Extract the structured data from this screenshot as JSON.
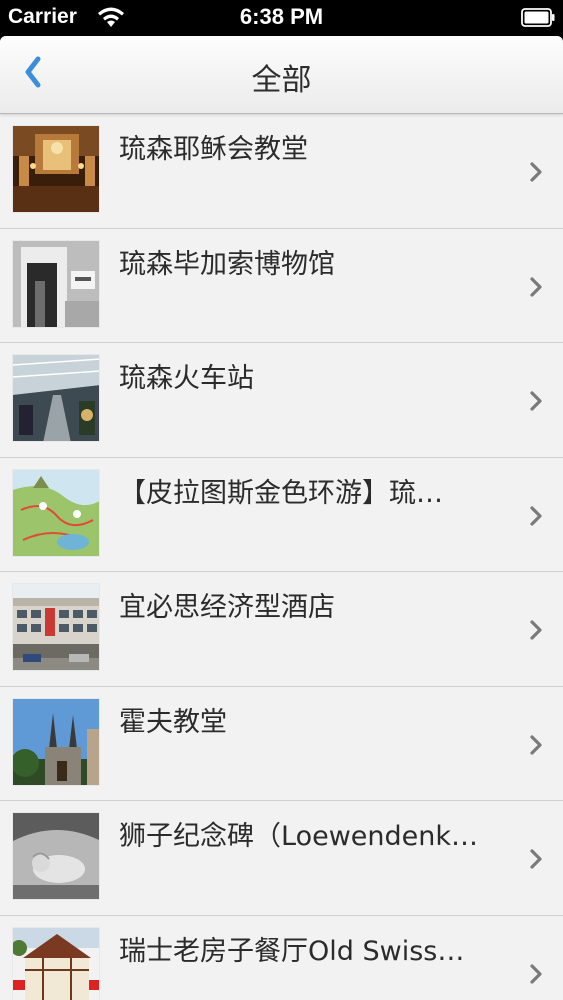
{
  "status_bar": {
    "carrier": "Carrier",
    "time": "6:38 PM",
    "icons": [
      "wifi-icon",
      "battery-icon"
    ]
  },
  "nav": {
    "title": "全部",
    "back_icon": "chevron-left-icon",
    "accent_color": "#3b8fd9"
  },
  "list": {
    "items": [
      {
        "label": "琉森耶稣会教堂",
        "thumb": "church-interior"
      },
      {
        "label": "琉森毕加索博物馆",
        "thumb": "museum-doorway"
      },
      {
        "label": "琉森火车站",
        "thumb": "train-station"
      },
      {
        "label": "【皮拉图斯金色环游】琉…",
        "thumb": "map"
      },
      {
        "label": "宜必思经济型酒店",
        "thumb": "hotel-building"
      },
      {
        "label": "霍夫教堂",
        "thumb": "church-spires"
      },
      {
        "label": "狮子纪念碑（Loewendenk…",
        "thumb": "lion-monument"
      },
      {
        "label": "瑞士老房子餐厅Old Swiss…",
        "thumb": "old-house"
      }
    ],
    "disclosure_icon": "chevron-right-icon"
  }
}
